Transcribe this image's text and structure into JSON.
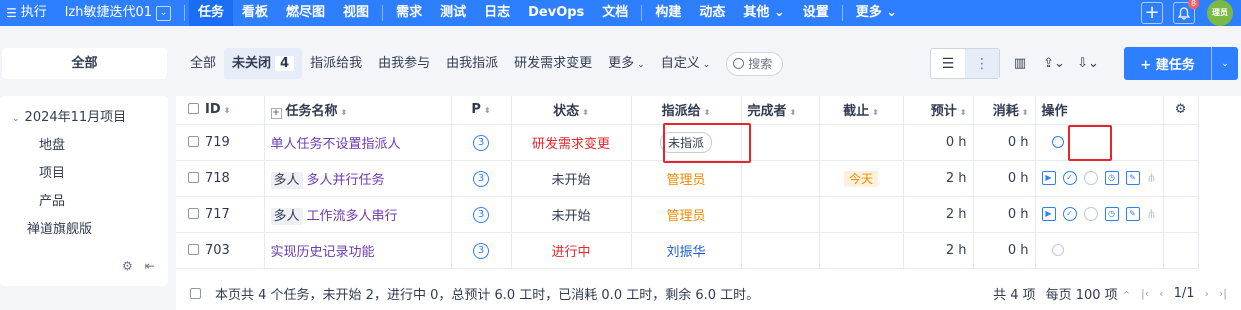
{
  "topbar": {
    "exec_label": "执行",
    "project_label": "lzh敏捷迭代01",
    "nav": [
      "任务",
      "看板",
      "燃尽图",
      "视图"
    ],
    "nav2": [
      "需求",
      "测试",
      "日志",
      "DevOps",
      "文档"
    ],
    "nav3": [
      "构建",
      "动态",
      "其他 ⌄",
      "设置"
    ],
    "more": "更多 ⌄",
    "notify_count": "8",
    "avatar_text": "理员"
  },
  "subbar": {
    "all_box": "全部",
    "filters": {
      "all": "全部",
      "unclosed": "未关闭",
      "unclosed_count": "4",
      "assigned_to_me": "指派给我",
      "participated": "由我参与",
      "assigned_by_me": "由我指派",
      "req_change": "研发需求变更",
      "more": "更多",
      "custom": "自定义"
    },
    "search_label": "搜索",
    "create_label": "建任务"
  },
  "sidebar": {
    "root": "2024年11月项目",
    "children": [
      "地盘",
      "项目",
      "产品"
    ],
    "other": "禅道旗舰版"
  },
  "table": {
    "headers": {
      "id": "ID",
      "name": "任务名称",
      "pri": "P",
      "status": "状态",
      "assigned": "指派给",
      "finished_by": "完成者",
      "deadline": "截止",
      "estimate": "预计",
      "consumed": "消耗",
      "actions": "操作"
    },
    "rows": [
      {
        "id": "719",
        "multi": "",
        "name": "单人任务不设置指派人",
        "pri": "3",
        "status": "研发需求变更",
        "assigned": "未指派",
        "finished_by": "",
        "deadline": "",
        "estimate": "0 h",
        "consumed": "0 h"
      },
      {
        "id": "718",
        "multi": "多人",
        "name": "多人并行任务",
        "pri": "3",
        "status": "未开始",
        "assigned": "管理员",
        "finished_by": "",
        "deadline": "今天",
        "estimate": "2 h",
        "consumed": "0 h"
      },
      {
        "id": "717",
        "multi": "多人",
        "name": "工作流多人串行",
        "pri": "3",
        "status": "未开始",
        "assigned": "管理员",
        "finished_by": "",
        "deadline": "",
        "estimate": "2 h",
        "consumed": "0 h"
      },
      {
        "id": "703",
        "multi": "",
        "name": "实现历史记录功能",
        "pri": "3",
        "status": "进行中",
        "assigned": "刘振华",
        "finished_by": "",
        "deadline": "",
        "estimate": "2 h",
        "consumed": "0 h"
      }
    ],
    "summary": "本页共 4 个任务，未开始 2，进行中 0，总预计 6.0 工时，已消耗 0.0 工时，剩余 6.0 工时。",
    "pager": {
      "total": "共 4 项",
      "per_page": "每页 100 项",
      "page": "1/1"
    }
  },
  "colors": {
    "brand": "#2e7fff",
    "highlight_box": "#e5262b"
  }
}
